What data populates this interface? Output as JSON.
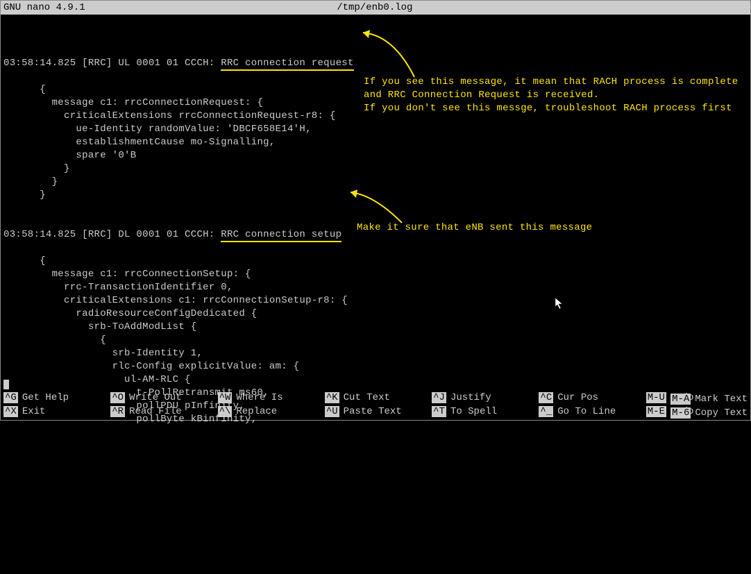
{
  "titlebar": {
    "app": "GNU nano 4.9.1",
    "filename": "/tmp/enb0.log"
  },
  "log": {
    "line1_prefix": "03:58:14.825 [RRC] UL 0001 01 CCCH: ",
    "line1_msg": "RRC connection request",
    "block1": [
      "      {",
      "        message c1: rrcConnectionRequest: {",
      "          criticalExtensions rrcConnectionRequest-r8: {",
      "            ue-Identity randomValue: 'DBCF658E14'H,",
      "            establishmentCause mo-Signalling,",
      "            spare '0'B",
      "          }",
      "        }",
      "      }",
      ""
    ],
    "line2_prefix": "03:58:14.825 [RRC] DL 0001 01 CCCH: ",
    "line2_msg": "RRC connection setup",
    "block2": [
      "      {",
      "        message c1: rrcConnectionSetup: {",
      "          rrc-TransactionIdentifier 0,",
      "          criticalExtensions c1: rrcConnectionSetup-r8: {",
      "            radioResourceConfigDedicated {",
      "              srb-ToAddModList {",
      "                {",
      "                  srb-Identity 1,",
      "                  rlc-Config explicitValue: am: {",
      "                    ul-AM-RLC {",
      "                      t-PollRetransmit ms60,",
      "                      pollPDU pInfinity,",
      "                      pollByte kBinfinity,"
    ]
  },
  "annotations": {
    "a1_l1": "If you see this message, it mean that RACH process is complete",
    "a1_l2": "and RRC Connection Request is received.",
    "a1_l3": "If you don't see this messge, troubleshoot RACH process first",
    "a2": "Make it sure that eNB sent this message"
  },
  "shortcuts": {
    "row1": [
      {
        "key": "^G",
        "label": "Get Help"
      },
      {
        "key": "^O",
        "label": "Write Out"
      },
      {
        "key": "^W",
        "label": "Where Is"
      },
      {
        "key": "^K",
        "label": "Cut Text"
      },
      {
        "key": "^J",
        "label": "Justify"
      },
      {
        "key": "^C",
        "label": "Cur Pos"
      },
      {
        "key": "M-U",
        "label": "Undo"
      }
    ],
    "row2": [
      {
        "key": "^X",
        "label": "Exit"
      },
      {
        "key": "^R",
        "label": "Read File"
      },
      {
        "key": "^\\",
        "label": "Replace"
      },
      {
        "key": "^U",
        "label": "Paste Text"
      },
      {
        "key": "^T",
        "label": "To Spell"
      },
      {
        "key": "^_",
        "label": "Go To Line"
      },
      {
        "key": "M-E",
        "label": "Redo"
      }
    ],
    "extra1": {
      "key": "M-A",
      "label": "Mark Text"
    },
    "extra2": {
      "key": "M-6",
      "label": "Copy Text"
    }
  }
}
